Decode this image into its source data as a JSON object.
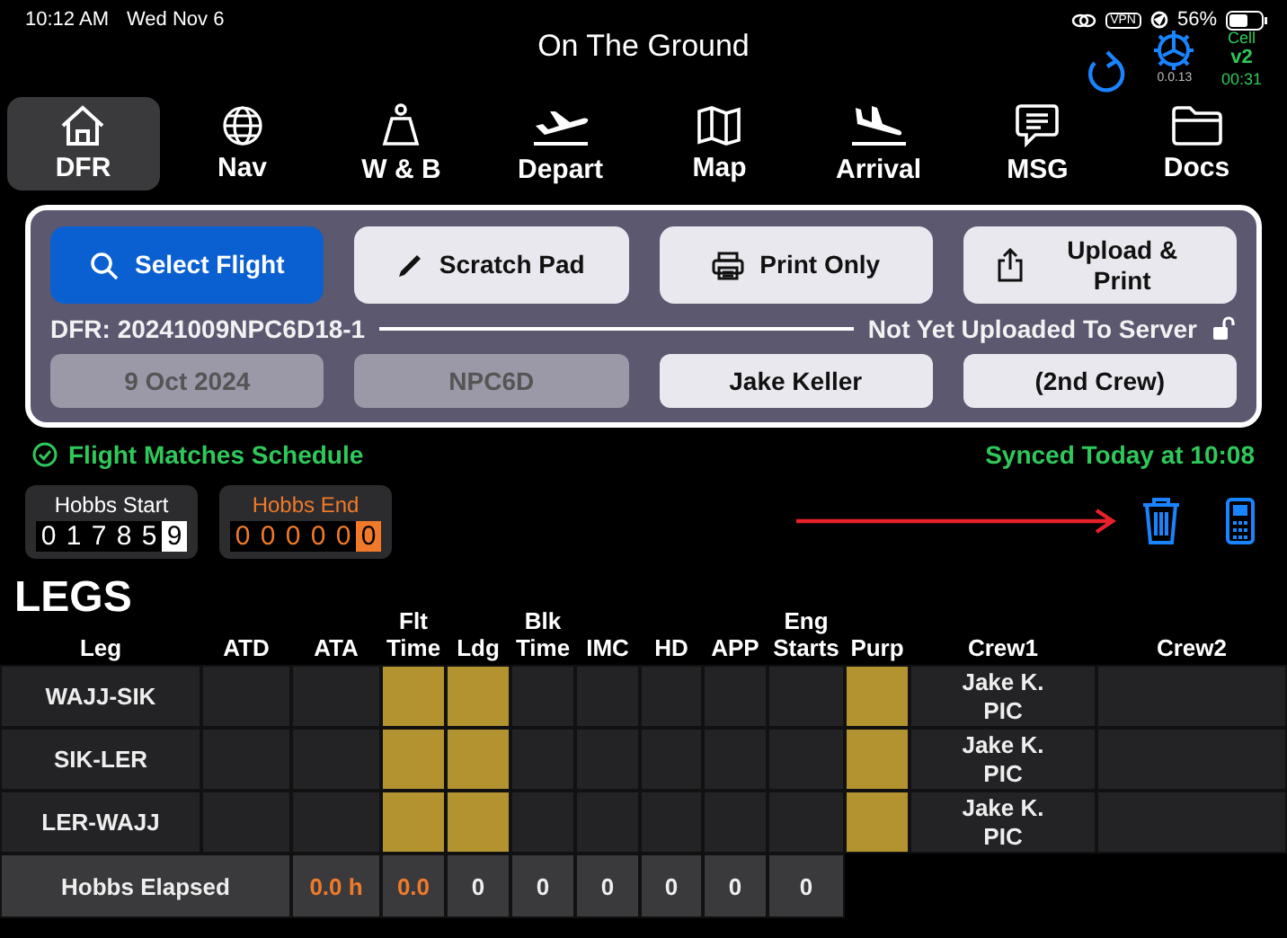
{
  "status_bar": {
    "time": "10:12 AM",
    "date": "Wed Nov 6",
    "vpn": "VPN",
    "battery": "56%"
  },
  "header": {
    "title": "On The Ground",
    "version": "0.0.13",
    "cell": {
      "label": "Cell",
      "version": "v2",
      "time": "00:31"
    }
  },
  "tabs": [
    {
      "label": "DFR",
      "selected": true
    },
    {
      "label": "Nav",
      "selected": false
    },
    {
      "label": "W & B",
      "selected": false
    },
    {
      "label": "Depart",
      "selected": false
    },
    {
      "label": "Map",
      "selected": false
    },
    {
      "label": "Arrival",
      "selected": false
    },
    {
      "label": "MSG",
      "selected": false
    },
    {
      "label": "Docs",
      "selected": false
    }
  ],
  "panel": {
    "buttons": [
      {
        "label": "Select Flight",
        "kind": "primary"
      },
      {
        "label": "Scratch Pad",
        "kind": "secondary"
      },
      {
        "label": "Print Only",
        "kind": "secondary"
      },
      {
        "label": "Upload & Print",
        "kind": "secondary"
      }
    ],
    "dfr_id": "DFR: 20241009NPC6D18-1",
    "upload_status": "Not Yet Uploaded To Server",
    "fields": [
      {
        "value": "9 Oct 2024",
        "disabled": true
      },
      {
        "value": "NPC6D",
        "disabled": true
      },
      {
        "value": "Jake Keller",
        "disabled": false
      },
      {
        "value": "(2nd Crew)",
        "disabled": false
      }
    ]
  },
  "schedule_status": "Flight Matches Schedule",
  "sync_status": "Synced Today at 10:08",
  "hobbs": [
    {
      "label": "Hobbs Start",
      "kind": "start",
      "digits": [
        "0",
        "1",
        "7",
        "8",
        "5",
        "9"
      ]
    },
    {
      "label": "Hobbs End",
      "kind": "end",
      "digits": [
        "0",
        "0",
        "0",
        "0",
        "0",
        "0"
      ]
    }
  ],
  "legs": {
    "title": "LEGS",
    "columns": [
      "Leg",
      "ATD",
      "ATA",
      "Flt Time",
      "Ldg",
      "Blk Time",
      "IMC",
      "HD",
      "APP",
      "Eng Starts",
      "Purp",
      "Crew1",
      "Crew2"
    ],
    "rows": [
      {
        "leg": "WAJJ-SIK",
        "cells": [
          {
            "required": false
          },
          {
            "required": false
          },
          {
            "required": true
          },
          {
            "required": true
          },
          {
            "required": false
          },
          {
            "required": false
          },
          {
            "required": false
          },
          {
            "required": false
          },
          {
            "required": false
          },
          {
            "required": true
          },
          {
            "required": false,
            "lines": [
              "Jake K.",
              "PIC"
            ]
          },
          {
            "required": false
          }
        ]
      },
      {
        "leg": "SIK-LER",
        "cells": [
          {
            "required": false
          },
          {
            "required": false
          },
          {
            "required": true
          },
          {
            "required": true
          },
          {
            "required": false
          },
          {
            "required": false
          },
          {
            "required": false
          },
          {
            "required": false
          },
          {
            "required": false
          },
          {
            "required": true
          },
          {
            "required": false,
            "lines": [
              "Jake K.",
              "PIC"
            ]
          },
          {
            "required": false
          }
        ]
      },
      {
        "leg": "LER-WAJJ",
        "cells": [
          {
            "required": false
          },
          {
            "required": false
          },
          {
            "required": true
          },
          {
            "required": true
          },
          {
            "required": false
          },
          {
            "required": false
          },
          {
            "required": false
          },
          {
            "required": false
          },
          {
            "required": false
          },
          {
            "required": true
          },
          {
            "required": false,
            "lines": [
              "Jake K.",
              "PIC"
            ]
          },
          {
            "required": false
          }
        ]
      }
    ],
    "totals": {
      "label": "Hobbs Elapsed",
      "values": [
        {
          "text": "0.0 h",
          "warning": true
        },
        {
          "text": "0.0",
          "warning": true
        },
        {
          "text": "0",
          "warning": false
        },
        {
          "text": "0",
          "warning": false
        },
        {
          "text": "0",
          "warning": false
        },
        {
          "text": "0",
          "warning": false
        },
        {
          "text": "0",
          "warning": false
        },
        {
          "text": "0",
          "warning": false
        }
      ]
    }
  }
}
